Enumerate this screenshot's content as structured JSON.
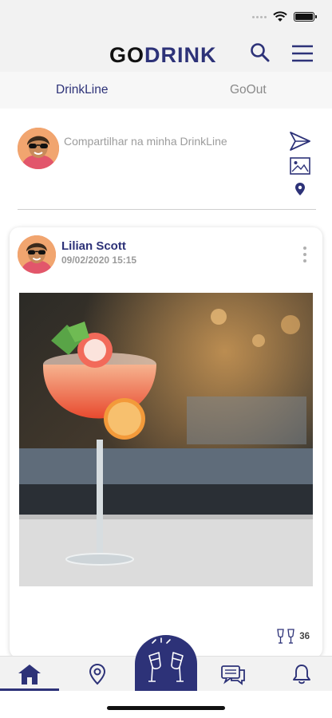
{
  "header": {
    "logo_go": "GO",
    "logo_drink": "DRINK"
  },
  "tabs": [
    {
      "label": "DrinkLine",
      "active": true
    },
    {
      "label": "GoOut",
      "active": false
    }
  ],
  "composer": {
    "placeholder": "Compartilhar na minha DrinkLine"
  },
  "post": {
    "author": "Lilian Scott",
    "timestamp": "09/02/2020 15:15",
    "cheers_count": "36"
  },
  "bottom_nav": {
    "items": [
      {
        "icon": "home-icon",
        "active": true
      },
      {
        "icon": "map-pin-icon",
        "active": false
      },
      {
        "icon": "cheers-icon",
        "active": false
      },
      {
        "icon": "chat-icon",
        "active": false
      },
      {
        "icon": "bell-icon",
        "active": false
      }
    ]
  },
  "colors": {
    "brand": "#2d3278",
    "header_bg": "#f2f2f2",
    "muted_text": "#9c9c9c"
  }
}
